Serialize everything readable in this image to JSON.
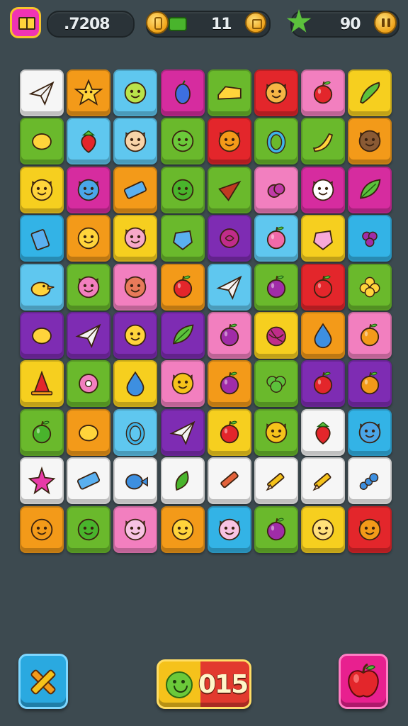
{
  "hud": {
    "coins": ".7208",
    "moves": "11",
    "stars": "90",
    "progress_fraction": 0.2
  },
  "footer": {
    "score": "015"
  },
  "colors": {
    "background": "#3d4a50",
    "tile_palette": {
      "white": "#f6f6f6",
      "yellow": "#f6cf1f",
      "orange": "#f39a19",
      "green": "#6ab92c",
      "sky": "#5fc7ef",
      "magenta": "#d62c9f",
      "red": "#e3262b",
      "purple": "#7e2cb3",
      "pink": "#f27fbf",
      "cyan": "#33b3e6"
    }
  },
  "board": {
    "rows": [
      [
        {
          "color": "white",
          "icon": "paper-plane-icon"
        },
        {
          "color": "orange",
          "icon": "star-icon"
        },
        {
          "color": "sky",
          "icon": "lime-face-icon"
        },
        {
          "color": "magenta",
          "icon": "blueberry-icon"
        },
        {
          "color": "green",
          "icon": "cheese-icon"
        },
        {
          "color": "red",
          "icon": "puppy-face-icon"
        },
        {
          "color": "pink",
          "icon": "apple-icon"
        },
        {
          "color": "yellow",
          "icon": "cucumber-icon"
        }
      ],
      [
        {
          "color": "green",
          "icon": "lemon-icon"
        },
        {
          "color": "sky",
          "icon": "strawberry-icon"
        },
        {
          "color": "sky",
          "icon": "elf-face-icon"
        },
        {
          "color": "green",
          "icon": "green-smiley-icon"
        },
        {
          "color": "red",
          "icon": "fox-face-icon"
        },
        {
          "color": "green",
          "icon": "ring-icon"
        },
        {
          "color": "green",
          "icon": "banana-icon"
        },
        {
          "color": "orange",
          "icon": "monkey-face-icon"
        }
      ],
      [
        {
          "color": "yellow",
          "icon": "cat-face-icon"
        },
        {
          "color": "magenta",
          "icon": "blue-monster-icon"
        },
        {
          "color": "orange",
          "icon": "eraser-icon"
        },
        {
          "color": "green",
          "icon": "cactus-face-icon"
        },
        {
          "color": "green",
          "icon": "pizza-slice-icon"
        },
        {
          "color": "pink",
          "icon": "berry-icon"
        },
        {
          "color": "magenta",
          "icon": "ghost-face-icon"
        },
        {
          "color": "magenta",
          "icon": "leaf-icon"
        }
      ],
      [
        {
          "color": "cyan",
          "icon": "juice-box-icon"
        },
        {
          "color": "orange",
          "icon": "sun-face-icon"
        },
        {
          "color": "yellow",
          "icon": "pig-face-icon"
        },
        {
          "color": "green",
          "icon": "gem-icon"
        },
        {
          "color": "purple",
          "icon": "rose-icon"
        },
        {
          "color": "sky",
          "icon": "peach-icon"
        },
        {
          "color": "yellow",
          "icon": "pink-gem-icon"
        },
        {
          "color": "cyan",
          "icon": "grapes-icon"
        }
      ],
      [
        {
          "color": "sky",
          "icon": "duck-icon"
        },
        {
          "color": "green",
          "icon": "pink-pig-icon"
        },
        {
          "color": "pink",
          "icon": "bear-face-icon"
        },
        {
          "color": "orange",
          "icon": "apple-icon"
        },
        {
          "color": "sky",
          "icon": "paper-plane-icon"
        },
        {
          "color": "green",
          "icon": "plum-icon"
        },
        {
          "color": "red",
          "icon": "apple-icon"
        },
        {
          "color": "green",
          "icon": "flower-icon"
        }
      ],
      [
        {
          "color": "purple",
          "icon": "lemon-icon"
        },
        {
          "color": "purple",
          "icon": "paper-plane-icon"
        },
        {
          "color": "purple",
          "icon": "smiley-icon"
        },
        {
          "color": "purple",
          "icon": "leaf-icon"
        },
        {
          "color": "pink",
          "icon": "plum-icon"
        },
        {
          "color": "yellow",
          "icon": "yarn-ball-icon"
        },
        {
          "color": "orange",
          "icon": "water-drop-icon"
        },
        {
          "color": "pink",
          "icon": "orange-fruit-icon"
        }
      ],
      [
        {
          "color": "yellow",
          "icon": "traffic-cone-icon"
        },
        {
          "color": "green",
          "icon": "donut-icon"
        },
        {
          "color": "yellow",
          "icon": "water-drop-icon"
        },
        {
          "color": "pink",
          "icon": "giraffe-face-icon"
        },
        {
          "color": "orange",
          "icon": "plum-icon"
        },
        {
          "color": "green",
          "icon": "broccoli-icon"
        },
        {
          "color": "purple",
          "icon": "apple-icon"
        },
        {
          "color": "purple",
          "icon": "orange-fruit-icon"
        }
      ],
      [
        {
          "color": "green",
          "icon": "watermelon-icon"
        },
        {
          "color": "orange",
          "icon": "lemon-icon"
        },
        {
          "color": "sky",
          "icon": "ring-icon"
        },
        {
          "color": "purple",
          "icon": "paper-plane-icon"
        },
        {
          "color": "yellow",
          "icon": "apple-icon"
        },
        {
          "color": "green",
          "icon": "pineapple-face-icon"
        },
        {
          "color": "white",
          "icon": "strawberry-icon"
        },
        {
          "color": "cyan",
          "icon": "blue-monster-icon"
        }
      ],
      [
        {
          "color": "white",
          "icon": "starfish-icon"
        },
        {
          "color": "white",
          "icon": "eraser-icon"
        },
        {
          "color": "white",
          "icon": "blue-fish-icon"
        },
        {
          "color": "white",
          "icon": "green-leaf-icon"
        },
        {
          "color": "white",
          "icon": "crayon-icon"
        },
        {
          "color": "white",
          "icon": "pencil-icon"
        },
        {
          "color": "white",
          "icon": "pencil-icon"
        },
        {
          "color": "white",
          "icon": "caterpillar-icon"
        }
      ],
      [
        {
          "color": "orange",
          "icon": "pumpkin-face-icon"
        },
        {
          "color": "green",
          "icon": "pickle-face-icon"
        },
        {
          "color": "pink",
          "icon": "sheep-face-icon"
        },
        {
          "color": "orange",
          "icon": "boy-face-icon"
        },
        {
          "color": "cyan",
          "icon": "sheep-face-icon"
        },
        {
          "color": "green",
          "icon": "plum-icon"
        },
        {
          "color": "yellow",
          "icon": "toast-face-icon"
        },
        {
          "color": "red",
          "icon": "tiger-face-icon"
        }
      ]
    ]
  }
}
